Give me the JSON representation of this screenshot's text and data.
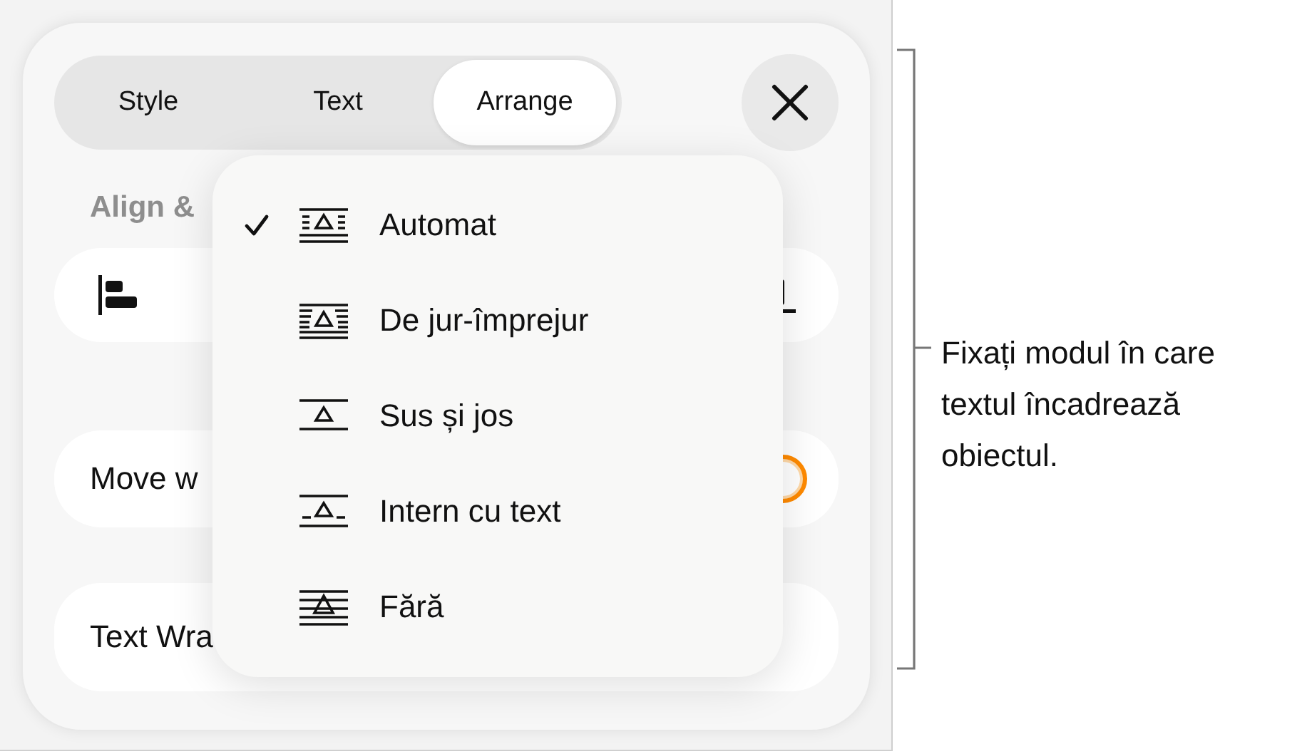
{
  "tabs": [
    {
      "label": "Style",
      "selected": false
    },
    {
      "label": "Text",
      "selected": false
    },
    {
      "label": "Arrange",
      "selected": true
    }
  ],
  "section_label": "Align &",
  "move_row": {
    "label": "Move w",
    "toggle": {
      "on": true
    }
  },
  "text_wrap_row": {
    "label": "Text Wra"
  },
  "wrap_menu": {
    "items": [
      {
        "label": "Automat",
        "kind": "automatic",
        "selected": true
      },
      {
        "label": "De jur-împrejur",
        "kind": "around",
        "selected": false
      },
      {
        "label": "Sus și jos",
        "kind": "top-bottom",
        "selected": false
      },
      {
        "label": "Intern cu text",
        "kind": "inline",
        "selected": false
      },
      {
        "label": "Fără",
        "kind": "none",
        "selected": false
      }
    ]
  },
  "callout": {
    "text": "Fixați modul în care textul încadrează obiectul."
  }
}
